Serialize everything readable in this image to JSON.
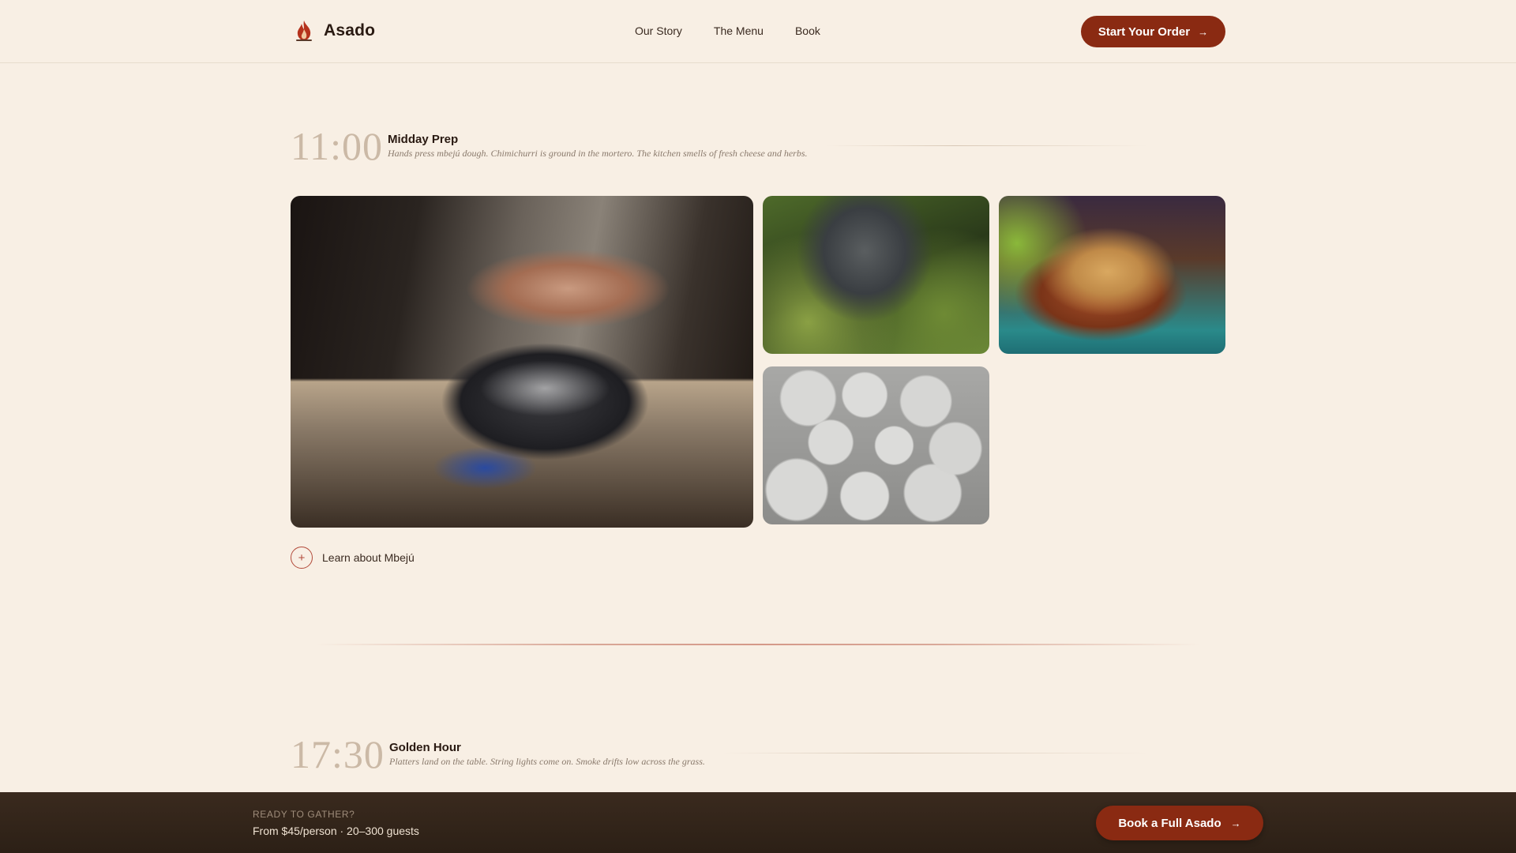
{
  "header": {
    "brand": "Asado",
    "logo_icon": "flame-logo-icon",
    "nav": [
      "Our Story",
      "The Menu",
      "Book"
    ],
    "cta_label": "Start Your Order",
    "cta_icon": "arrow-right-icon",
    "accent_color": "#8a2a12"
  },
  "sections": [
    {
      "time": "11:00",
      "title": "Midday Prep",
      "description": "Hands press mbejú dough. Chimichurri is ground in the mortero. The kitchen smells of fresh cheese and herbs.",
      "photos": [
        "hands-pressing-dough-photo",
        "mortar-herbs-photo",
        "chips-bowl-photo",
        "dough-balls-photo"
      ],
      "learn_more_label": "Learn about Mbejú",
      "learn_more_icon": "plus-circle-icon"
    },
    {
      "time": "17:30",
      "title": "Golden Hour",
      "description": "Platters land on the table. String lights come on. Smoke drifts low across the grass."
    }
  ],
  "bottom_bar": {
    "kicker": "READY TO GATHER?",
    "text": "From $45/person · 20–300 guests",
    "cta_label": "Book a Full Asado",
    "cta_icon": "arrow-right-icon"
  }
}
